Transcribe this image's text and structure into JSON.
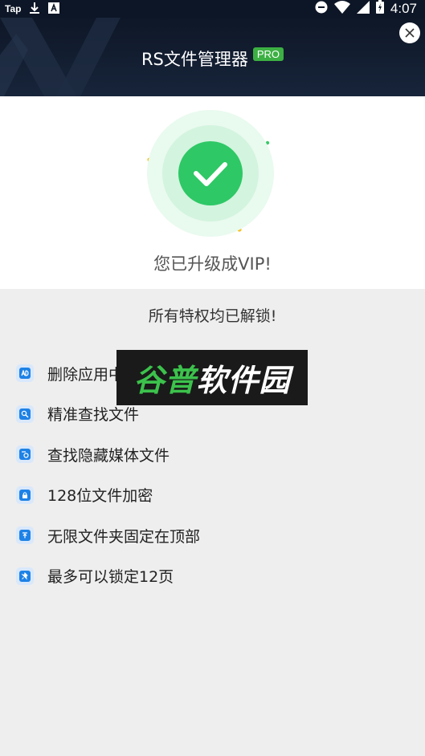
{
  "status_bar": {
    "carrier": "Tap",
    "time": "4:07"
  },
  "header": {
    "title": "RS文件管理器",
    "badge": "PRO"
  },
  "hero": {
    "message": "您已升级成VIP!"
  },
  "unlock_message": "所有特权均已解锁!",
  "features": [
    {
      "label": "删除应用中的所有广告",
      "icon": "ad-icon"
    },
    {
      "label": "精准查找文件",
      "icon": "file-search-icon"
    },
    {
      "label": "查找隐藏媒体文件",
      "icon": "hidden-media-icon"
    },
    {
      "label": "128位文件加密",
      "icon": "lock-icon"
    },
    {
      "label": "无限文件夹固定在顶部",
      "icon": "folder-pin-icon"
    },
    {
      "label": "最多可以锁定12页",
      "icon": "pin-icon"
    }
  ],
  "watermark": {
    "part1": "谷普",
    "part2": "软件园"
  },
  "colors": {
    "header_bg": "#0e1727",
    "accent_green": "#2ec866",
    "badge_green": "#3cb043",
    "icon_blue": "#1e82e6"
  }
}
